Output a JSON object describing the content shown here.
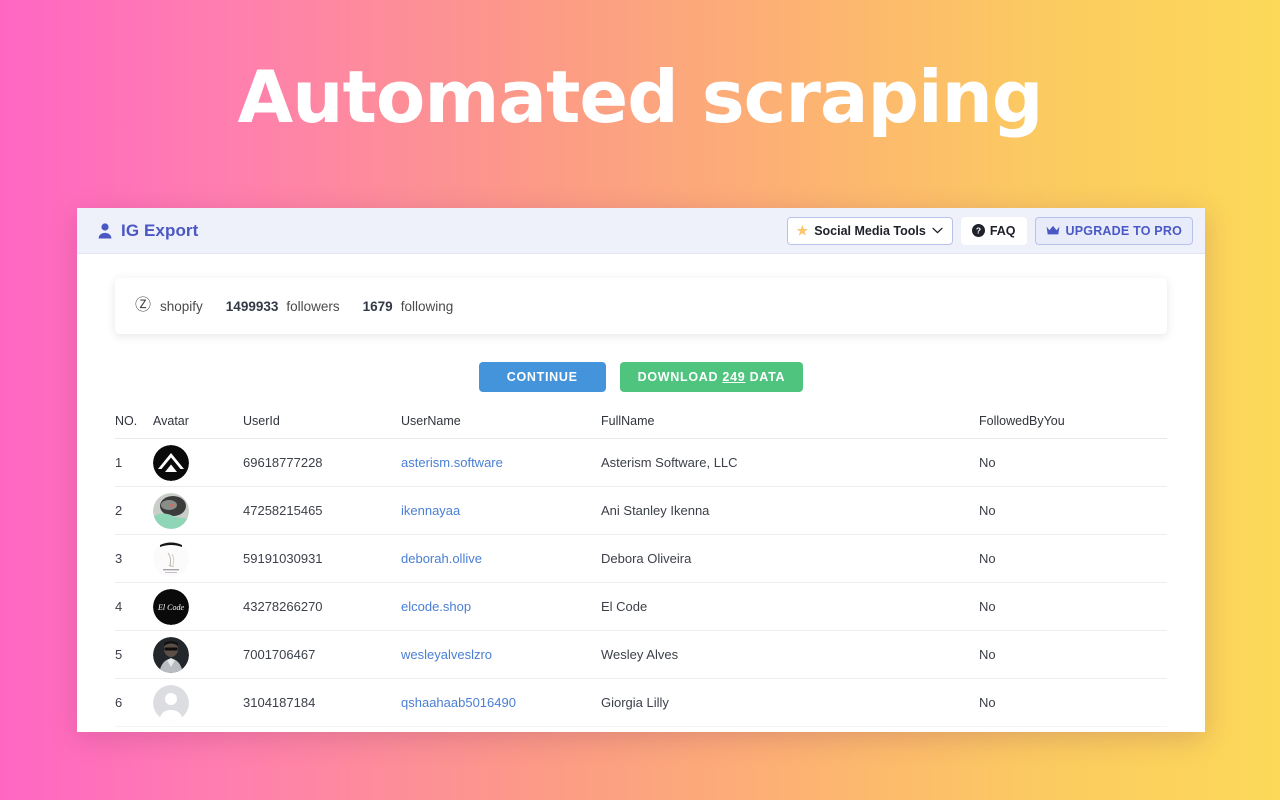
{
  "headline": "Automated scraping",
  "theme": {
    "gradient_start": "#FF66C4",
    "gradient_mid": "#FC9A87",
    "gradient_end": "#FCD959",
    "brand_color": "#4A58C4",
    "link_color": "#4A7FD4",
    "continue_color": "#4494DB",
    "download_color": "#4FC47E",
    "topbar_bg": "#EEF0FA"
  },
  "topbar": {
    "brand": "IG Export",
    "brand_icon": "person-icon",
    "tools_label": "Social Media Tools",
    "tools_icon": "star-icon",
    "tools_caret": "chevron-down-icon",
    "faq_label": "FAQ",
    "faq_icon": "help-circle-icon",
    "upgrade_label": "UPGRADE TO PRO",
    "upgrade_icon": "crown-icon"
  },
  "account": {
    "at_icon": "at-icon",
    "username": "shopify",
    "followers_count": "1499933",
    "followers_label": "followers",
    "following_count": "1679",
    "following_label": "following"
  },
  "actions": {
    "continue_label": "CONTINUE",
    "download_prefix": "DOWNLOAD ",
    "download_count": "249",
    "download_suffix": " DATA"
  },
  "table": {
    "headers": [
      "NO.",
      "Avatar",
      "UserId",
      "UserName",
      "FullName",
      "FollowedByYou"
    ],
    "rows": [
      {
        "no": "1",
        "avatar": "asterism-logo-avatar",
        "userid": "69618777228",
        "username": "asterism.software",
        "fullname": "Asterism Software, LLC",
        "followed": "No"
      },
      {
        "no": "2",
        "avatar": "photo-avatar-ikennayaa",
        "userid": "47258215465",
        "username": "ikennayaa",
        "fullname": "Ani Stanley Ikenna",
        "followed": "No"
      },
      {
        "no": "3",
        "avatar": "sketch-avatar-deborah",
        "userid": "59191030931",
        "username": "deborah.ollive",
        "fullname": "Debora Oliveira",
        "followed": "No"
      },
      {
        "no": "4",
        "avatar": "elcode-logo-avatar",
        "userid": "43278266270",
        "username": "elcode.shop",
        "fullname": "El Code",
        "followed": "No"
      },
      {
        "no": "5",
        "avatar": "photo-avatar-wesley",
        "userid": "7001706467",
        "username": "wesleyalveslzro",
        "fullname": "Wesley Alves",
        "followed": "No"
      },
      {
        "no": "6",
        "avatar": "default-placeholder-avatar",
        "userid": "3104187184",
        "username": "qshaahaab5016490",
        "fullname": "Giorgia Lilly",
        "followed": "No"
      }
    ]
  }
}
